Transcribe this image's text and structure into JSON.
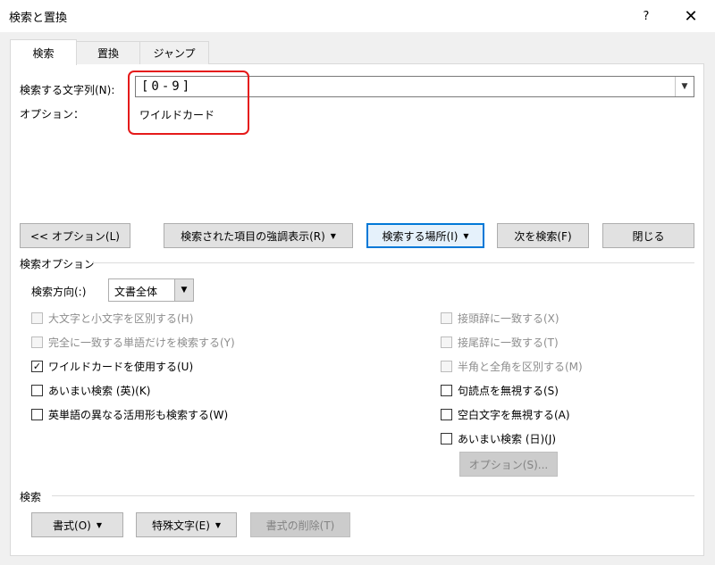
{
  "window": {
    "title": "検索と置換",
    "help": "?",
    "close": "✕"
  },
  "tabs": [
    {
      "label": "検索"
    },
    {
      "label": "置換"
    },
    {
      "label": "ジャンプ"
    }
  ],
  "find": {
    "label": "検索する文字列(N):",
    "value": "[0-9]",
    "options_label": "オプション：",
    "options_value": "ワイルドカード"
  },
  "buttons": {
    "less_options": "<< オプション(L)",
    "highlight": "検索された項目の強調表示(R)",
    "find_in": "検索する場所(I)",
    "find_next": "次を検索(F)",
    "close": "閉じる"
  },
  "search_options": {
    "section_label": "検索オプション",
    "direction_label": "検索方向(:)",
    "direction_value": "文書全体",
    "left_checks": [
      {
        "label": "大文字と小文字を区別する(H)",
        "checked": false,
        "disabled": true
      },
      {
        "label": "完全に一致する単語だけを検索する(Y)",
        "checked": false,
        "disabled": true
      },
      {
        "label": "ワイルドカードを使用する(U)",
        "checked": true,
        "disabled": false
      },
      {
        "label": "あいまい検索 (英)(K)",
        "checked": false,
        "disabled": false
      },
      {
        "label": "英単語の異なる活用形も検索する(W)",
        "checked": false,
        "disabled": false
      }
    ],
    "right_checks": [
      {
        "label": "接頭辞に一致する(X)",
        "checked": false,
        "disabled": true
      },
      {
        "label": "接尾辞に一致する(T)",
        "checked": false,
        "disabled": true
      },
      {
        "label": "半角と全角を区別する(M)",
        "checked": false,
        "disabled": true
      },
      {
        "label": "句読点を無視する(S)",
        "checked": false,
        "disabled": false
      },
      {
        "label": "空白文字を無視する(A)",
        "checked": false,
        "disabled": false
      },
      {
        "label": "あいまい検索 (日)(J)",
        "checked": false,
        "disabled": false
      }
    ],
    "options_button": "オプション(S)..."
  },
  "search_section": {
    "label": "検索",
    "format": "書式(O)",
    "special": "特殊文字(E)",
    "no_format": "書式の削除(T)"
  }
}
